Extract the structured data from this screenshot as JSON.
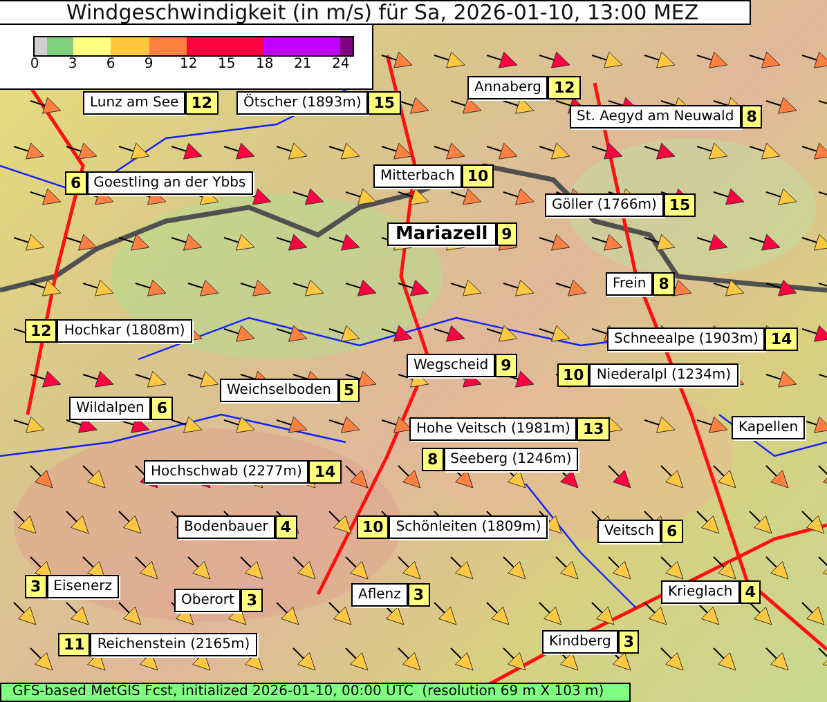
{
  "title": "Windgeschwindigkeit (in m/s) für Sa, 2026-01-10, 13:00 MEZ",
  "legend": {
    "segments": [
      {
        "color": "#d0d0d0"
      },
      {
        "color": "#80d080"
      },
      {
        "color": "#ffff80"
      },
      {
        "color": "#ffc840"
      },
      {
        "color": "#ff8040"
      },
      {
        "color": "#ff0040"
      },
      {
        "color": "#ff0040"
      },
      {
        "color": "#c000ff"
      },
      {
        "color": "#c000ff"
      },
      {
        "color": "#800080"
      }
    ],
    "ticks": [
      "0",
      "3",
      "6",
      "9",
      "12",
      "15",
      "18",
      "21",
      "24"
    ]
  },
  "stations": [
    {
      "name": "Lunz am See",
      "value": "12",
      "value_first": false,
      "major": false
    },
    {
      "name": "Ötscher (1893m)",
      "value": "15",
      "value_first": false,
      "major": false
    },
    {
      "name": "Annaberg",
      "value": "12",
      "value_first": false,
      "major": false
    },
    {
      "name": "St. Aegyd am Neuwald",
      "value": "8",
      "value_first": false,
      "major": false
    },
    {
      "name": "Goestling an der Ybbs",
      "value": "6",
      "value_first": true,
      "major": false
    },
    {
      "name": "Mitterbach",
      "value": "10",
      "value_first": false,
      "major": false
    },
    {
      "name": "Göller (1766m)",
      "value": "15",
      "value_first": false,
      "major": false
    },
    {
      "name": "Mariazell",
      "value": "9",
      "value_first": false,
      "major": true
    },
    {
      "name": "Frein",
      "value": "8",
      "value_first": false,
      "major": false
    },
    {
      "name": "Hochkar (1808m)",
      "value": "12",
      "value_first": true,
      "major": false
    },
    {
      "name": "Schneealpe (1903m)",
      "value": "14",
      "value_first": false,
      "major": false
    },
    {
      "name": "Wegscheid",
      "value": "9",
      "value_first": false,
      "major": false
    },
    {
      "name": "Niederalpl (1234m)",
      "value": "10",
      "value_first": true,
      "major": false
    },
    {
      "name": "Weichselboden",
      "value": "5",
      "value_first": false,
      "major": false
    },
    {
      "name": "Wildalpen",
      "value": "6",
      "value_first": false,
      "major": false
    },
    {
      "name": "Kapellen",
      "major": false
    },
    {
      "name": "Hohe Veitsch (1981m)",
      "value": "13",
      "value_first": false,
      "major": false
    },
    {
      "name": "Seeberg (1246m)",
      "value": "8",
      "value_first": true,
      "major": false
    },
    {
      "name": "Hochschwab (2277m)",
      "value": "14",
      "value_first": false,
      "major": false
    },
    {
      "name": "Bodenbauer",
      "value": "4",
      "value_first": false,
      "major": false
    },
    {
      "name": "Schönleiten (1809m)",
      "value": "10",
      "value_first": true,
      "major": false
    },
    {
      "name": "Veitsch",
      "value": "6",
      "value_first": false,
      "major": false
    },
    {
      "name": "Eisenerz",
      "value": "3",
      "value_first": true,
      "major": false
    },
    {
      "name": "Krieglach",
      "value": "4",
      "value_first": false,
      "major": false
    },
    {
      "name": "Oberort",
      "value": "3",
      "value_first": false,
      "major": false
    },
    {
      "name": "Aflenz",
      "value": "3",
      "value_first": false,
      "major": false
    },
    {
      "name": "Reichenstein (2165m)",
      "value": "11",
      "value_first": true,
      "major": false
    },
    {
      "name": "Kindberg",
      "value": "3",
      "value_first": false,
      "major": false
    }
  ],
  "footer": "GFS-based MetGIS Fcst, initialized 2026-01-10, 00:00 UTC  (resolution 69 m X 103 m)"
}
